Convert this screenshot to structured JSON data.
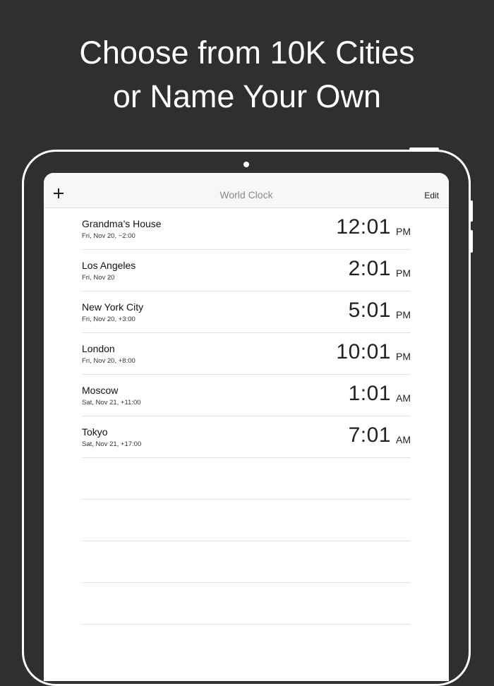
{
  "headline": {
    "line1": "Choose from 10K Cities",
    "line2": "or Name Your Own"
  },
  "navbar": {
    "add_icon": "plus-icon",
    "title": "World Clock",
    "edit_label": "Edit"
  },
  "clocks": [
    {
      "city": "Grandma’s House",
      "detail": "Fri, Nov 20, −2:00",
      "time": "12:01",
      "ampm": "PM"
    },
    {
      "city": "Los Angeles",
      "detail": "Fri, Nov 20",
      "time": "2:01",
      "ampm": "PM"
    },
    {
      "city": "New York City",
      "detail": "Fri, Nov 20, +3:00",
      "time": "5:01",
      "ampm": "PM"
    },
    {
      "city": "London",
      "detail": "Fri, Nov 20, +8:00",
      "time": "10:01",
      "ampm": "PM"
    },
    {
      "city": "Moscow",
      "detail": "Sat, Nov 21, +11:00",
      "time": "1:01",
      "ampm": "AM"
    },
    {
      "city": "Tokyo",
      "detail": "Sat, Nov 21, +17:00",
      "time": "7:01",
      "ampm": "AM"
    }
  ],
  "colors": {
    "background": "#2f2f2f",
    "screen": "#ffffff",
    "navbar": "#f7f7f7",
    "separator": "#e2e2e2"
  }
}
